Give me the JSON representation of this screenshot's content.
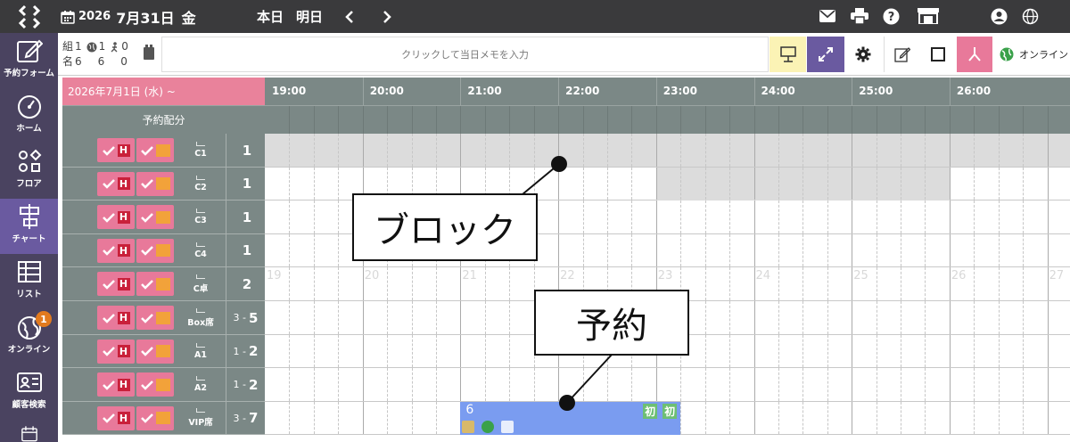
{
  "top_bar": {
    "year": "2026",
    "month_day": "7月31日",
    "weekday": "金",
    "today_label": "本日",
    "tomorrow_label": "明日",
    "prev_icon": "chevron-left-icon",
    "next_icon": "chevron-right-icon",
    "right_icons": [
      "mail-icon",
      "printer-icon",
      "help-icon",
      "store-icon",
      "user-icon",
      "globe-icon"
    ]
  },
  "sidebar": {
    "items": [
      {
        "label": "予約フォーム",
        "icon": "edit-icon"
      },
      {
        "label": "ホーム",
        "icon": "gauge-icon"
      },
      {
        "label": "フロア",
        "icon": "floor-icon"
      },
      {
        "label": "チャート",
        "icon": "chart-icon",
        "active": true
      },
      {
        "label": "リスト",
        "icon": "list-icon"
      },
      {
        "label": "オンライン",
        "icon": "globe-icon",
        "badge": "1"
      },
      {
        "label": "顧客検索",
        "icon": "contact-card-icon"
      },
      {
        "label": "",
        "icon": "calendar-icon"
      }
    ]
  },
  "toolbar": {
    "groups_label": "組",
    "groups_value": "1",
    "online_groups": "1",
    "walkin_groups": "0",
    "people_label": "名",
    "people_value": "6",
    "online_people": "6",
    "walkin_people": "0",
    "memo_placeholder": "クリックして当日メモを入力",
    "online_label": "オンライン"
  },
  "chart": {
    "date_header": "2026年7月1日 (水) ~",
    "allocation_label": "予約配分",
    "hours": [
      "19:00",
      "20:00",
      "21:00",
      "22:00",
      "23:00",
      "24:00",
      "25:00",
      "26:00"
    ],
    "faint_hours": [
      "19",
      "20",
      "21",
      "22",
      "23",
      "24",
      "25",
      "26",
      "27"
    ],
    "tables": [
      {
        "name": "C1",
        "capacity": "1",
        "range": ""
      },
      {
        "name": "C2",
        "capacity": "1",
        "range": ""
      },
      {
        "name": "C3",
        "capacity": "1",
        "range": ""
      },
      {
        "name": "C4",
        "capacity": "1",
        "range": ""
      },
      {
        "name": "C卓",
        "capacity": "2",
        "range": ""
      },
      {
        "name": "Box席",
        "capacity": "5",
        "range": "3 -"
      },
      {
        "name": "A1",
        "capacity": "2",
        "range": "1 -"
      },
      {
        "name": "A2",
        "capacity": "2",
        "range": "1 -"
      },
      {
        "name": "VIP席",
        "capacity": "7",
        "range": "3 -"
      }
    ],
    "reservation": {
      "party_size": "6",
      "first_visit_label": "初",
      "first_visit_label_2": "初",
      "table": "VIP席",
      "start": "21:00",
      "end": "23:15"
    }
  },
  "callouts": {
    "block_label": "ブロック",
    "reservation_label": "予約"
  },
  "colors": {
    "topbar": "#3a3a3c",
    "sidebar": "#4a4360",
    "accent_pink": "#e9829b",
    "reservation_blue": "#7a9cf0",
    "first_visit_green": "#6dbf73",
    "block_gray": "#dcdcdc"
  }
}
